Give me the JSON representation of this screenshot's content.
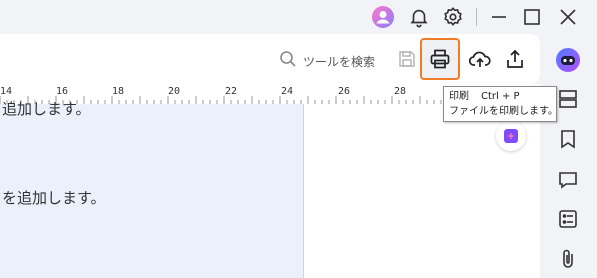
{
  "toolbar": {
    "search_label": "ツールを検索"
  },
  "ruler": {
    "ticks": [
      "14",
      "16",
      "18",
      "20",
      "22",
      "24",
      "26",
      "28"
    ]
  },
  "document": {
    "line1": "追加します。",
    "line2": "を追加します。"
  },
  "tooltip": {
    "title": "印刷",
    "shortcut": "Ctrl + P",
    "description": "ファイルを印刷します。"
  },
  "icons": {
    "avatar": "avatar-icon",
    "bell": "bell-icon",
    "settings": "gear-icon",
    "minimize": "minimize-icon",
    "maximize": "maximize-icon",
    "close": "close-icon",
    "search": "search-icon",
    "save": "save-icon",
    "print": "print-icon",
    "upload_cloud": "cloud-upload-icon",
    "share": "share-icon",
    "ai_assistant": "ai-assistant-icon",
    "layout": "layout-icon",
    "bookmark": "bookmark-icon",
    "comment": "comment-icon",
    "form": "form-icon",
    "attachment": "paperclip-icon",
    "floating_ai": "floating-ai-icon"
  },
  "colors": {
    "highlight": "#f07b2a",
    "doc_page": "#eaf1fb",
    "accent_purple": "#7b4dff"
  }
}
